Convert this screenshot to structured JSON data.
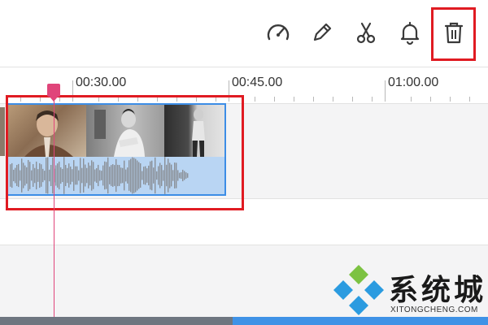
{
  "toolbar": {
    "items": [
      {
        "name": "speed-icon",
        "label": "Speed"
      },
      {
        "name": "pencil-icon",
        "label": "Edit"
      },
      {
        "name": "scissors-icon",
        "label": "Split"
      },
      {
        "name": "bell-icon",
        "label": "Notifications"
      },
      {
        "name": "trash-icon",
        "label": "Delete"
      }
    ],
    "icon_color": "#3a3a3a"
  },
  "timeline": {
    "ruler_labels": [
      "00:30.00",
      "00:45.00",
      "01:00.00"
    ]
  },
  "clip": {
    "thumbnail_count": 3,
    "border_color": "#3c8de6",
    "fill_color": "#b9d5f3"
  },
  "playhead": {
    "color": "#e0457a"
  },
  "highlight_color": "#e01b22",
  "watermark": {
    "title": "系统城",
    "subtitle": "XITONGCHENG.COM"
  }
}
